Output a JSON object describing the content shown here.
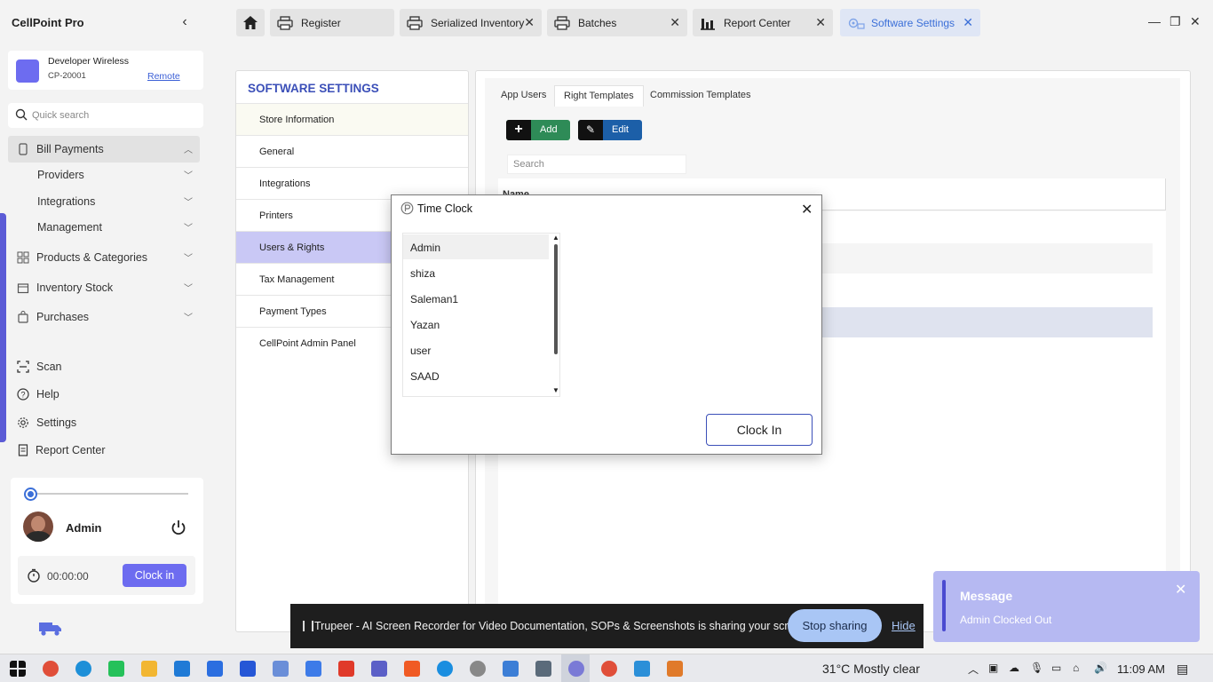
{
  "app": {
    "title": "CellPoint Pro",
    "collapse_icon": "chevron-left-icon"
  },
  "store": {
    "name": "Developer Wireless",
    "id": "CP-20001",
    "mode_link": "Remote"
  },
  "sidebar_search": {
    "placeholder": "Quick search"
  },
  "nav": {
    "bill_payments": "Bill Payments",
    "providers": "Providers",
    "integrations": "Integrations",
    "management": "Management",
    "products": "Products & Categories",
    "inventory": "Inventory Stock",
    "purchases": "Purchases",
    "scan": "Scan",
    "help": "Help",
    "settings": "Settings",
    "report_center": "Report Center"
  },
  "user_panel": {
    "name": "Admin",
    "timer": "00:00:00",
    "clock_button": "Clock in"
  },
  "tabs": [
    {
      "label": "Register"
    },
    {
      "label": "Serialized Inventory"
    },
    {
      "label": "Batches"
    },
    {
      "label": "Report Center"
    },
    {
      "label": "Software Settings"
    }
  ],
  "settings": {
    "title": "SOFTWARE SETTINGS",
    "items": [
      "Store Information",
      "General",
      "Integrations",
      "Printers",
      "Users & Rights",
      "Tax Management",
      "Payment Types",
      "CellPoint Admin Panel"
    ]
  },
  "sub_tabs": [
    "App Users",
    "Right Templates",
    "Commission Templates"
  ],
  "actions": {
    "add": "Add",
    "edit": "Edit"
  },
  "grid": {
    "search_placeholder": "Search",
    "col_name": "Name"
  },
  "modal": {
    "title": "Time Clock",
    "users": [
      "Admin",
      "shiza",
      "Saleman1",
      "Yazan",
      "user",
      "SAAD"
    ],
    "clock_in": "Clock In"
  },
  "share_bar": {
    "message": "Trupeer - AI Screen Recorder for Video Documentation, SOPs & Screenshots is sharing your screen.",
    "stop": "Stop sharing",
    "hide": "Hide"
  },
  "toast": {
    "title": "Message",
    "text": "Admin Clocked Out"
  },
  "taskbar": {
    "weather": "31°C  Mostly clear",
    "time": "11:09 AM"
  },
  "colors": {
    "accent": "#6d6cf0",
    "title_blue": "#3b4fb8",
    "add_green": "#2e8b57",
    "edit_blue": "#1c5fa8",
    "toast": "#b6b9f2"
  }
}
